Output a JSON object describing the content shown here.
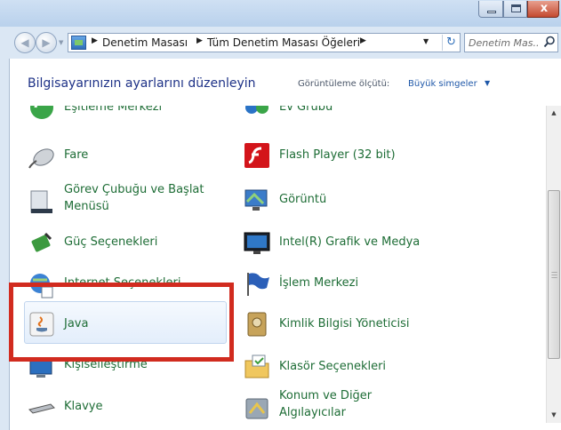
{
  "titlebar": {
    "minimize_glyph": "",
    "close_glyph": "x"
  },
  "nav": {
    "back_glyph": "◀",
    "forward_glyph": "▶",
    "breadcrumbs": [
      "Denetim Masası",
      "Tüm Denetim Masası Öğeleri"
    ],
    "refresh_glyph": "↻"
  },
  "search": {
    "placeholder": "Denetim Mas..."
  },
  "header": {
    "title": "Bilgisayarınızın ayarlarını düzenleyin",
    "view_by_label": "Görüntüleme ölçütü:",
    "view_by_value": "Büyük simgeler"
  },
  "items": {
    "left": [
      {
        "label": "Eşitleme Merkezi",
        "icon": "sync-center-icon"
      },
      {
        "label": "Fare",
        "icon": "mouse-icon"
      },
      {
        "label": "Görev Çubuğu ve Başlat",
        "label2": "Menüsü",
        "icon": "taskbar-icon"
      },
      {
        "label": "Güç Seçenekleri",
        "icon": "power-options-icon"
      },
      {
        "label": "Internet Seçenekleri",
        "icon": "internet-options-icon"
      },
      {
        "label": "Java",
        "icon": "java-icon"
      },
      {
        "label": "Kişiselleştirme",
        "icon": "personalization-icon"
      },
      {
        "label": "Klavye",
        "icon": "keyboard-icon"
      }
    ],
    "right": [
      {
        "label": "Ev Grubu",
        "icon": "homegroup-icon"
      },
      {
        "label": "Flash Player (32 bit)",
        "icon": "flash-player-icon"
      },
      {
        "label": "Görüntü",
        "icon": "display-icon"
      },
      {
        "label": "Intel(R) Grafik ve Medya",
        "icon": "intel-graphics-icon"
      },
      {
        "label": "İşlem Merkezi",
        "icon": "action-center-icon"
      },
      {
        "label": "Kimlik Bilgisi Yöneticisi",
        "icon": "credential-manager-icon"
      },
      {
        "label": "Klasör Seçenekleri",
        "icon": "folder-options-icon"
      },
      {
        "label": "Konum ve Diğer",
        "label2": "Algılayıcılar",
        "icon": "location-sensors-icon"
      }
    ]
  },
  "colors": {
    "link_green": "#1e6d36",
    "title_blue": "#1e3287",
    "highlight_red": "#d12b1f"
  }
}
